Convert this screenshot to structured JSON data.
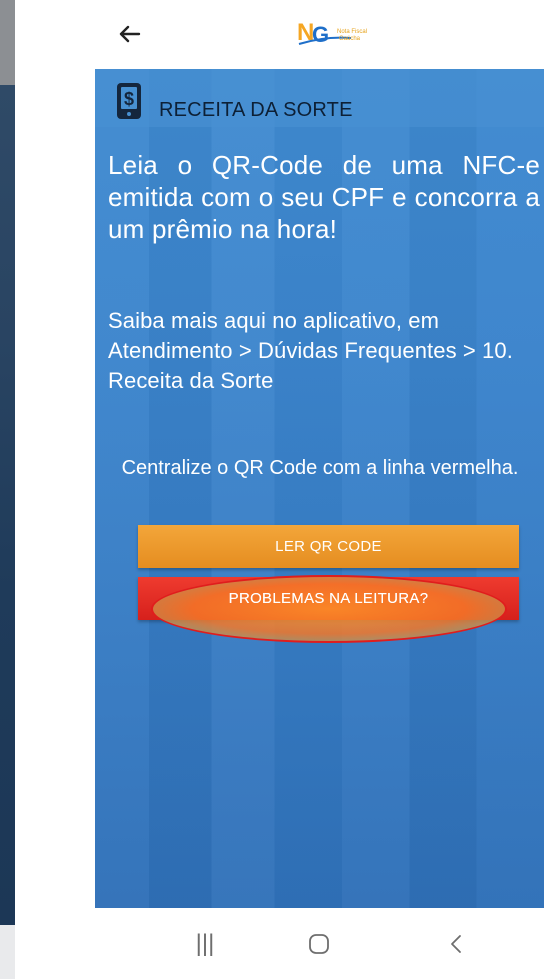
{
  "topbar": {
    "back_icon": "arrow-left-icon",
    "logo_text": "NFG",
    "logo_subtext": "Nota Fiscal Gaúcha"
  },
  "header": {
    "icon": "wallet-dollar-icon",
    "title": "RECEITA DA SORTE"
  },
  "content": {
    "main_text": "Leia o QR-Code de uma NFC-e emitida com o seu CPF e concorra a um prêmio na hora!",
    "sub_text": "Saiba mais aqui no aplicativo, em Atendimento > Dúvidas Frequentes > 10. Receita da Sorte",
    "hint": "Centralize o QR Code com a linha vermelha."
  },
  "buttons": {
    "read_qr": "LER QR CODE",
    "problems": "PROBLEMAS NA LEITURA?"
  },
  "colors": {
    "accent_orange": "#e58d20",
    "accent_red": "#d6201c",
    "background_blue": "#3b84cc",
    "highlight_outline": "#e01d1d"
  },
  "navbar": {
    "recent_icon": "recent-apps-icon",
    "home_icon": "home-icon",
    "back_icon": "back-chevron-icon"
  }
}
